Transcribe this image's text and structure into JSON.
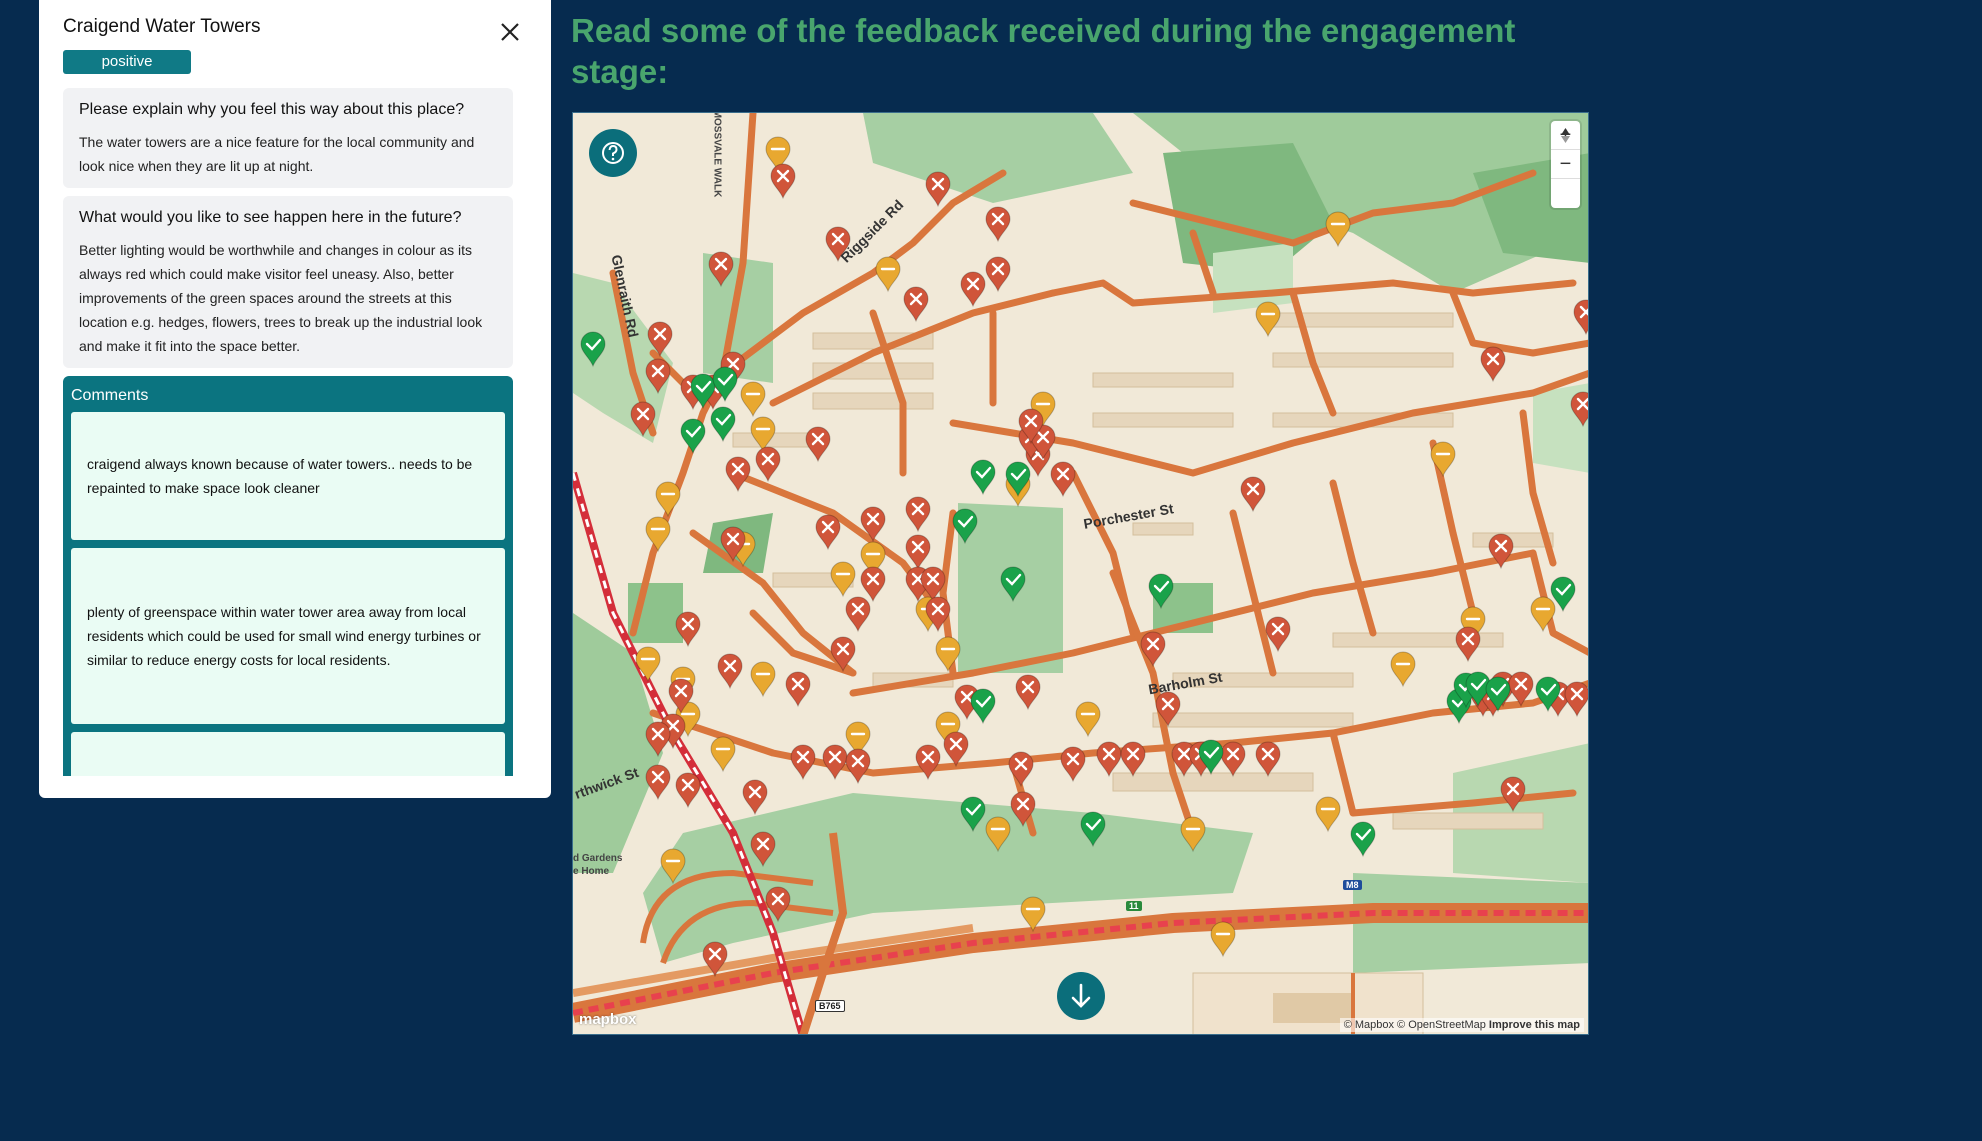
{
  "panel": {
    "title": "Craigend Water Towers",
    "sentiment": "positive",
    "questions": [
      {
        "question": "Please explain why you feel this way about this place?",
        "answer": "The water towers are a nice feature for the local community and look nice when they are lit up at night."
      },
      {
        "question": "What would you like to see happen here in the future?",
        "answer": "Better lighting would be worthwhile and changes in colour as its always red which could make visitor feel uneasy. Also, better improvements of the green spaces around the streets at this location e.g. hedges, flowers, trees to break up the industrial look and make it fit into the space better."
      }
    ],
    "comments_title": "Comments",
    "comments": [
      "craigend always known because of water towers.. needs to be repainted to make space look cleaner",
      "plenty of greenspace within water tower area away from local residents which could be used for small wind energy turbines or similar to reduce energy costs for local residents."
    ]
  },
  "heading": "Read some of the feedback received during the engagement stage:",
  "map": {
    "streets": [
      "Porchester St",
      "Barholm St",
      "Riggside Rd",
      "Glenraith Rd",
      "MOSSVALE WALK",
      "rthwick St"
    ],
    "small_labels": [
      "d Gardens",
      "e Home"
    ],
    "road_shields": [
      "M8",
      "11",
      "B765"
    ],
    "zoom_in": "+",
    "zoom_out": "−",
    "mapbox_logo": "mapbox",
    "attribution": "© Mapbox © OpenStreetMap",
    "improve": "Improve this map",
    "colors": {
      "positive": "#1aa24a",
      "neutral": "#e8a830",
      "negative": "#d0553a"
    },
    "legend_icons": [
      "help-icon",
      "arrow-down-icon",
      "compass-icon"
    ]
  }
}
